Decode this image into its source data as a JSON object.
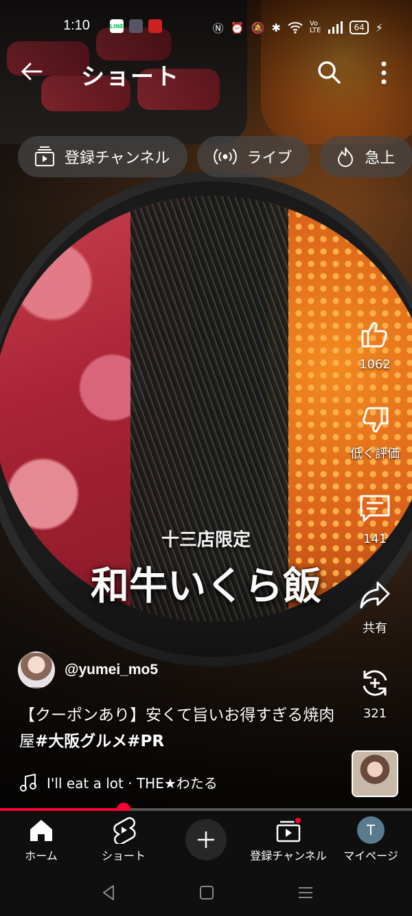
{
  "status_bar": {
    "time": "1:10",
    "apps": [
      "LINE",
      "app",
      "app"
    ],
    "battery": "64"
  },
  "header": {
    "title": "ショート"
  },
  "chips": [
    {
      "label": "登録チャンネル",
      "icon": "subscriptions-icon"
    },
    {
      "label": "ライブ",
      "icon": "live-icon"
    },
    {
      "label": "急上",
      "icon": "trending-icon"
    }
  ],
  "overlay": {
    "subtitle": "十三店限定",
    "title": "和牛いくら飯"
  },
  "actions": {
    "like_count": "1062",
    "dislike_label": "低く評価",
    "comment_count": "141",
    "share_label": "共有",
    "remix_count": "321"
  },
  "channel": {
    "handle": "@yumei_mo5"
  },
  "description": {
    "text": "【クーポンあり】安くて旨いお得すぎる焼肉屋",
    "tags": "#大阪グルメ#PR"
  },
  "music": {
    "track": "I'll eat a lot · THE★わたる"
  },
  "progress": {
    "fraction": 0.3
  },
  "bottom_nav": {
    "home": "ホーム",
    "shorts": "ショート",
    "subscriptions": "登録チャンネル",
    "you": "マイページ",
    "avatar_letter": "T"
  },
  "colors": {
    "accent": "#ff0033",
    "chip_bg": "#464646",
    "nav_bg": "#0f0f0f"
  }
}
